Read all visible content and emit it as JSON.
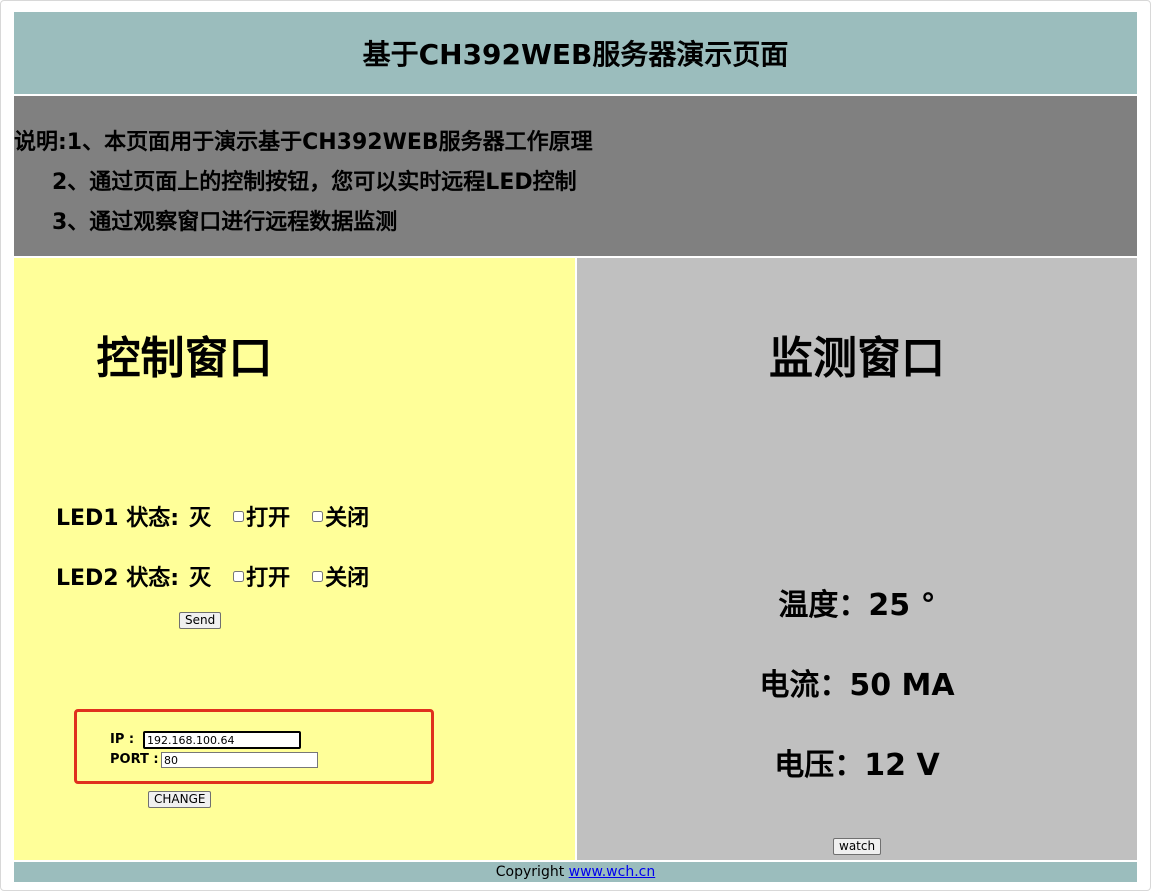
{
  "header": {
    "title": "基于CH392WEB服务器演示页面"
  },
  "description": {
    "lines": [
      "说明:1、本页面用于演示基于CH392WEB服务器工作原理",
      "2、通过页面上的控制按钮，您可以实时远程LED控制",
      "3、通过观察窗口进行远程数据监测"
    ]
  },
  "control": {
    "title": "控制窗口",
    "leds": [
      {
        "label": "LED1 状态:",
        "state": "灭",
        "on_label": "打开",
        "off_label": "关闭",
        "on_checked": false,
        "off_checked": false
      },
      {
        "label": "LED2 状态:",
        "state": "灭",
        "on_label": "打开",
        "off_label": "关闭",
        "on_checked": false,
        "off_checked": false
      }
    ],
    "send_label": "Send",
    "network": {
      "ip_label": "IP   :",
      "ip_value": "192.168.100.64",
      "port_label": "PORT :",
      "port_value": "80"
    },
    "change_label": "CHANGE"
  },
  "monitor": {
    "title": "监测窗口",
    "temperature": "温度：25 °",
    "current": "电流：50 MA",
    "voltage": "电压：12 V",
    "watch_label": "watch"
  },
  "footer": {
    "copyright_text": "Copyright",
    "link_text": "www.wch.cn"
  },
  "colors": {
    "header_bg": "#9bbdbd",
    "desc_bg": "#808080",
    "control_bg": "#ffff99",
    "monitor_bg": "#c0c0c0",
    "highlight_border": "#e0301e",
    "link": "#0000ee"
  }
}
